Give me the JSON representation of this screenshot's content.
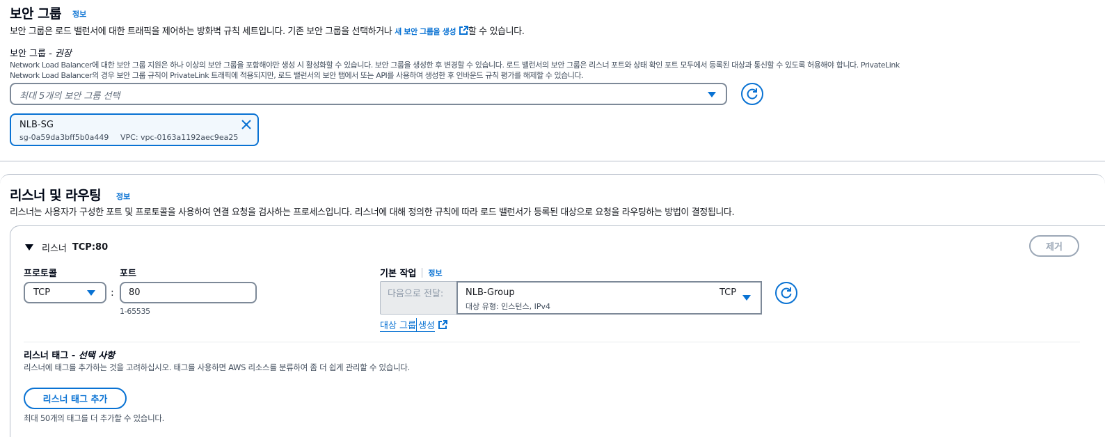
{
  "security_groups": {
    "title": "보안 그룹",
    "info": "정보",
    "description_prefix": "보안 그룹은 로드 밸런서에 대한 트래픽을 제어하는 방화벽 규칙 세트입니다. 기존 보안 그룹을 선택하거나",
    "create_link": "새 보안 그룹을 생성",
    "description_suffix": "할 수 있습니다.",
    "field_label": "보안 그룹 -",
    "field_label_optional": "권장",
    "field_desc_line1": "Network Load Balancer에 대한 보안 그룹 지원은 하나 이상의 보안 그룹을 포함해야만 생성 시 활성화할 수 있습니다. 보안 그룹을 생성한 후 변경할 수 있습니다. 로드 밸런서의 보안 그룹은 리스너 포트와 상태 확인 포트 모두에서 등록된 대상과 통신할 수 있도록 허용해야 합니다. PrivateLink",
    "field_desc_line2": "Network Load Balancer의 경우 보안 그룹 규칙이 PrivateLink 트래픽에 적용되지만, 로드 밸런서의 보안 탭에서 또는 API를 사용하여 생성한 후 인바운드 규칙 평가를 해제할 수 있습니다.",
    "select_placeholder": "최대 5개의 보안 그룹 선택",
    "token": {
      "name": "NLB-SG",
      "id": "sg-0a59da3bff5b0a449",
      "vpc": "VPC: vpc-0163a1192aec9ea25"
    }
  },
  "listeners": {
    "title": "리스너 및 라우팅",
    "info": "정보",
    "description": "리스너는 사용자가 구성한 포트 및 프로토콜을 사용하여 연결 요청을 검사하는 프로세스입니다. 리스너에 대해 정의한 규칙에 따라 로드 밸런서가 등록된 대상으로 요청을 라우팅하는 방법이 결정됩니다.",
    "listener": {
      "header_prefix": "리스너",
      "header_name": "TCP:80",
      "remove_button": "제거",
      "protocol_label": "프로토콜",
      "protocol_value": "TCP",
      "port_label": "포트",
      "port_value": "80",
      "port_hint": "1-65535",
      "colon": ":",
      "default_action_label": "기본 작업",
      "default_action_info": "정보",
      "forward_to_label": "다음으로 전달:",
      "target_group_name": "NLB-Group",
      "target_group_detail": "대상 유형: 인스턴스, IPv4",
      "target_group_protocol": "TCP",
      "create_target_group_link_a": "대상 그룹",
      "create_target_group_link_b": "생성",
      "tags_label": "리스너 태그 -",
      "tags_label_optional": "선택 사항",
      "tags_desc": "리스너에 태그를 추가하는 것을 고려하십시오. 태그를 사용하면 AWS 리소스를 분류하여 좀 더 쉽게 관리할 수 있습니다.",
      "add_tag_button": "리스너 태그 추가",
      "tags_hint": "최대 50개의 태그를 더 추가할 수 있습니다."
    }
  },
  "colors": {
    "accent": "#0972d3",
    "text": "#16191f",
    "border": "#7d8998",
    "disabled": "#9ba7b6"
  }
}
